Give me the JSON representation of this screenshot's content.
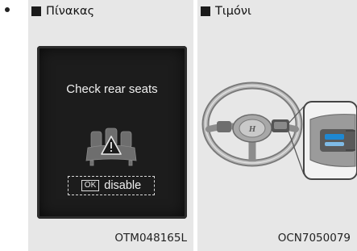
{
  "left_panel": {
    "header": "Πίνακας",
    "display_message": "Check rear seats",
    "ok_key_label": "OK",
    "disable_label": "disable",
    "caption": "OTM048165L"
  },
  "right_panel": {
    "header": "Τιμόνι",
    "caption": "OCN7050079"
  },
  "icons": {
    "bullet": "bullet-dot",
    "header_marker": "black-square",
    "display_icon": "rear-seats-warning-icon",
    "illustration": "steering-wheel-with-button-zoom"
  }
}
